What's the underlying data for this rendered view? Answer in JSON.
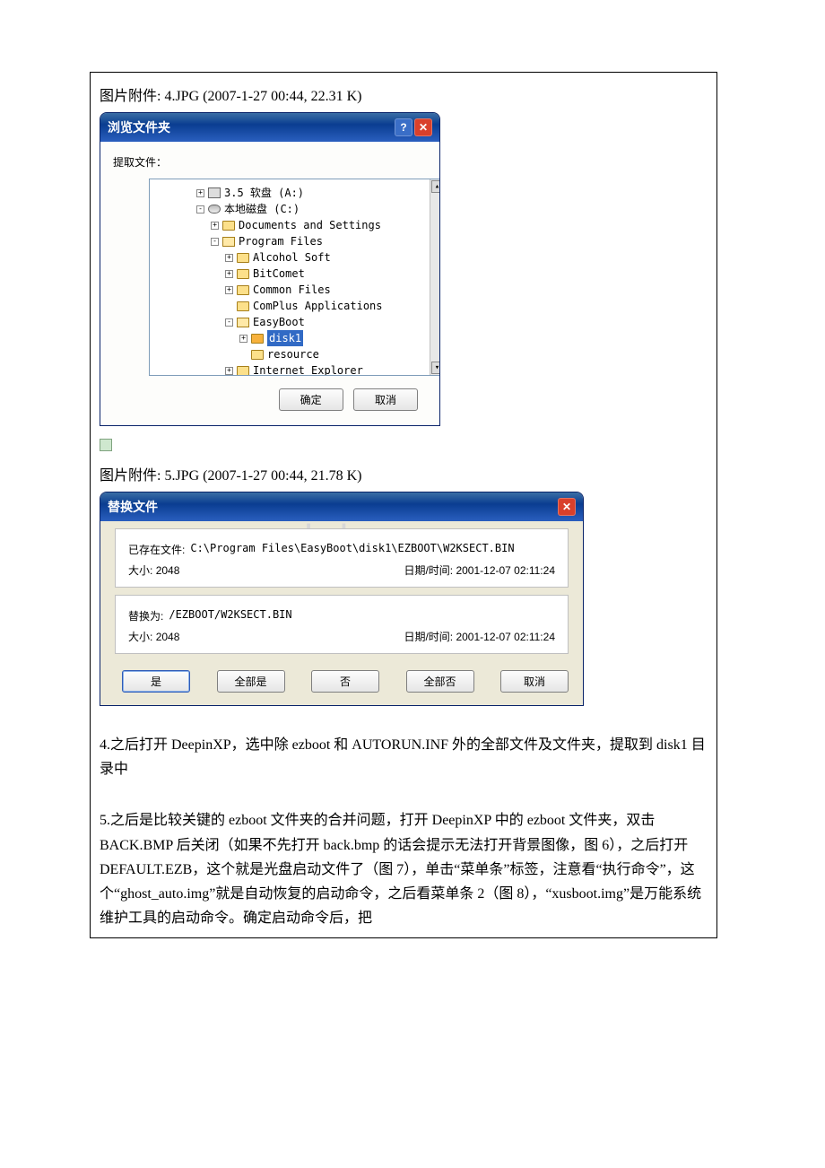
{
  "attachment1": {
    "prefix": "图片附件:",
    "name": "4.JPG",
    "meta": "(2007-1-27 00:44, 22.31 K)"
  },
  "attachment2": {
    "prefix": "图片附件:",
    "name": "5.JPG",
    "meta": "(2007-1-27 00:44, 21.78 K)"
  },
  "browse_dialog": {
    "title": "浏览文件夹",
    "help_btn": "?",
    "close_btn": "✕",
    "prompt": "提取文件：",
    "tree": {
      "items": [
        {
          "indent": 3,
          "exp": "+",
          "icon": "floppy",
          "label": "3.5 软盘 (A:)"
        },
        {
          "indent": 3,
          "exp": "-",
          "icon": "disk",
          "label": "本地磁盘 (C:)"
        },
        {
          "indent": 4,
          "exp": "+",
          "icon": "folder",
          "label": "Documents and Settings"
        },
        {
          "indent": 4,
          "exp": "-",
          "icon": "folder-open",
          "label": "Program Files"
        },
        {
          "indent": 5,
          "exp": "+",
          "icon": "folder",
          "label": "Alcohol Soft"
        },
        {
          "indent": 5,
          "exp": "+",
          "icon": "folder",
          "label": "BitComet"
        },
        {
          "indent": 5,
          "exp": "+",
          "icon": "folder",
          "label": "Common Files"
        },
        {
          "indent": 5,
          "exp": " ",
          "icon": "folder",
          "label": "ComPlus Applications"
        },
        {
          "indent": 5,
          "exp": "-",
          "icon": "folder-open",
          "label": "EasyBoot"
        },
        {
          "indent": 6,
          "exp": "+",
          "icon": "folder-sel",
          "label": "disk1",
          "selected": true
        },
        {
          "indent": 6,
          "exp": " ",
          "icon": "folder",
          "label": "resource"
        },
        {
          "indent": 5,
          "exp": "+",
          "icon": "folder",
          "label": "Internet Explorer"
        }
      ]
    },
    "scroll_up": "▴",
    "scroll_down": "▾",
    "ok": "确定",
    "cancel": "取消"
  },
  "replace_dialog": {
    "title": "替换文件",
    "close_btn": "✕",
    "existing": {
      "label": "已存在文件:",
      "path": "C:\\Program Files\\EasyBoot\\disk1\\EZBOOT\\W2KSECT.BIN",
      "size_label": "大小:",
      "size": "2048",
      "date_label": "日期/时间:",
      "date": "2001-12-07 02:11:24"
    },
    "replace": {
      "label": "替换为:",
      "path": "/EZBOOT/W2KSECT.BIN",
      "size_label": "大小:",
      "size": "2048",
      "date_label": "日期/时间:",
      "date": "2001-12-07 02:11:24"
    },
    "buttons": {
      "yes": "是",
      "yes_all": "全部是",
      "no": "否",
      "no_all": "全部否",
      "cancel": "取消"
    }
  },
  "paragraphs": {
    "p4": "4.之后打开 DeepinXP，选中除 ezboot 和 AUTORUN.INF 外的全部文件及文件夹，提取到 disk1 目录中",
    "p5": "5.之后是比较关键的 ezboot 文件夹的合并问题，打开 DeepinXP 中的 ezboot 文件夹，双击 BACK.BMP 后关闭（如果不先打开 back.bmp 的话会提示无法打开背景图像，图 6），之后打开 DEFAULT.EZB，这个就是光盘启动文件了（图 7），单击“菜单条”标签，注意看“执行命令”，这个“ghost_auto.img”就是自动恢复的启动命令，之后看菜单条 2（图 8），“xusboot.img”是万能系统维护工具的启动命令。确定启动命令后，把"
  },
  "watermark": "www.bdocx.com"
}
